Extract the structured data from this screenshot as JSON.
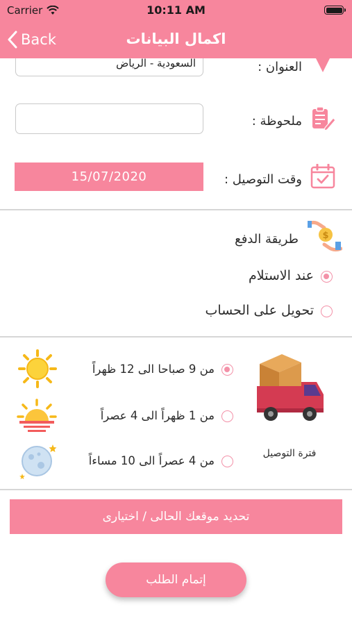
{
  "status_bar": {
    "carrier": "Carrier",
    "time": "10:11 AM"
  },
  "nav": {
    "back_label": "Back",
    "title": "اكمال البيانات"
  },
  "form": {
    "address_label": "العنوان :",
    "address_value": "السعودية - الرياض",
    "note_label": "ملحوظة :",
    "note_value": "",
    "delivery_time_label": "وقت التوصيل :",
    "delivery_date": "15/07/2020"
  },
  "payment": {
    "title": "طريقة الدفع",
    "options": [
      {
        "label": "عند الاستلام",
        "selected": true
      },
      {
        "label": "تحويل على الحساب",
        "selected": false
      }
    ]
  },
  "delivery_period": {
    "label": "فترة التوصيل",
    "slots": [
      {
        "label": "من 9 صباحا الى 12 ظهراً",
        "icon": "sun-icon",
        "selected": true
      },
      {
        "label": "من 1 ظهراً الى 4 عصراً",
        "icon": "sunset-icon",
        "selected": false
      },
      {
        "label": "من 4 عصراً الى 10 مساءاً",
        "icon": "moon-icon",
        "selected": false
      }
    ]
  },
  "location_button": "تحديد موقعك الحالى / اختيارى",
  "submit_button": "إتمام الطلب",
  "colors": {
    "accent": "#f7869d",
    "radio": "#f391a8",
    "divider": "#d6d6d6"
  }
}
